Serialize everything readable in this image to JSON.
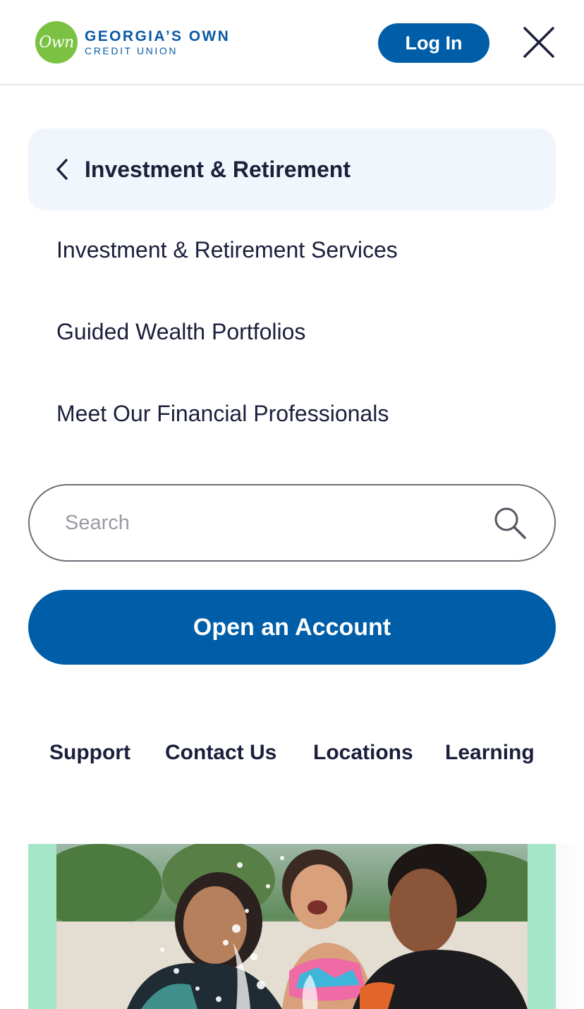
{
  "header": {
    "logo_mark": "Own",
    "logo_line1": "GEORGIA’S OWN",
    "logo_line2": "CREDIT UNION",
    "login_label": "Log In",
    "close_icon": "close-icon"
  },
  "menu": {
    "back_label": "Investment & Retirement",
    "items": [
      {
        "label": "Investment & Retirement Services"
      },
      {
        "label": "Guided Wealth Portfolios"
      },
      {
        "label": "Meet Our Financial Professionals"
      }
    ]
  },
  "search": {
    "placeholder": "Search",
    "icon": "search-icon"
  },
  "cta": {
    "open_account_label": "Open an Account"
  },
  "footer": {
    "links": [
      {
        "label": "Support"
      },
      {
        "label": "Contact Us"
      },
      {
        "label": "Locations"
      },
      {
        "label": "Learning"
      }
    ]
  },
  "colors": {
    "brand_blue": "#005ea8",
    "logo_green": "#7cc242",
    "text_navy": "#1b1f3b",
    "menu_highlight": "#f1f6fd",
    "promo_mint": "#a6e6c8"
  }
}
